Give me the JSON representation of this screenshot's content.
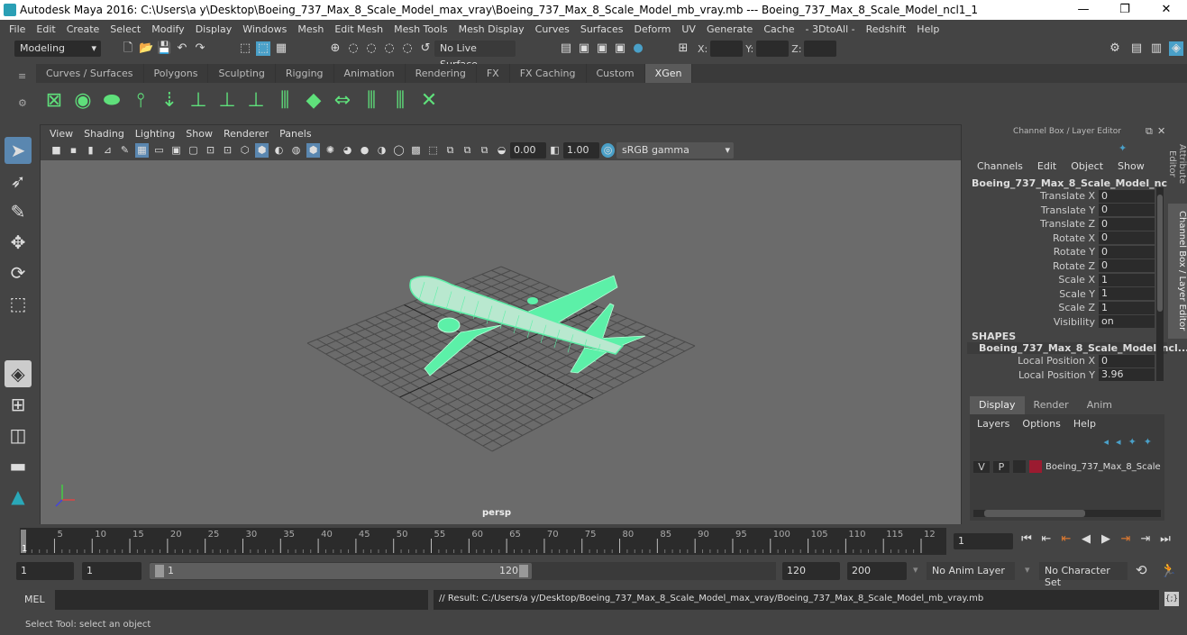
{
  "window": {
    "title": "Autodesk Maya 2016: C:\\Users\\a y\\Desktop\\Boeing_737_Max_8_Scale_Model_max_vray\\Boeing_737_Max_8_Scale_Model_mb_vray.mb  ---  Boeing_737_Max_8_Scale_Model_ncl1_1",
    "minimize": "—",
    "maximize": "❐",
    "close": "✕"
  },
  "menu": [
    "File",
    "Edit",
    "Create",
    "Select",
    "Modify",
    "Display",
    "Windows",
    "Mesh",
    "Edit Mesh",
    "Mesh Tools",
    "Mesh Display",
    "Curves",
    "Surfaces",
    "Deform",
    "UV",
    "Generate",
    "Cache",
    "- 3DtoAll -",
    "Redshift",
    "Help"
  ],
  "status": {
    "mode": "Modeling",
    "live_surface": "No Live Surface",
    "x_label": "X:",
    "y_label": "Y:",
    "z_label": "Z:"
  },
  "shelf": {
    "tabs": [
      "Curves / Surfaces",
      "Polygons",
      "Sculpting",
      "Rigging",
      "Animation",
      "Rendering",
      "FX",
      "FX Caching",
      "Custom",
      "XGen"
    ],
    "active": "XGen"
  },
  "viewport": {
    "menu": [
      "View",
      "Shading",
      "Lighting",
      "Show",
      "Renderer",
      "Panels"
    ],
    "exposure": "0.00",
    "gamma": "1.00",
    "color_space": "sRGB gamma",
    "camera": "persp"
  },
  "channel_box": {
    "title": "Channel Box / Layer Editor",
    "menu": [
      "Channels",
      "Edit",
      "Object",
      "Show"
    ],
    "object": "Boeing_737_Max_8_Scale_Model_ncl1_1",
    "channels": [
      {
        "label": "Translate X",
        "value": "0"
      },
      {
        "label": "Translate Y",
        "value": "0"
      },
      {
        "label": "Translate Z",
        "value": "0"
      },
      {
        "label": "Rotate X",
        "value": "0"
      },
      {
        "label": "Rotate Y",
        "value": "0"
      },
      {
        "label": "Rotate Z",
        "value": "0"
      },
      {
        "label": "Scale X",
        "value": "1"
      },
      {
        "label": "Scale Y",
        "value": "1"
      },
      {
        "label": "Scale Z",
        "value": "1"
      },
      {
        "label": "Visibility",
        "value": "on"
      }
    ],
    "shapes_header": "SHAPES",
    "shape_name": "Boeing_737_Max_8_Scale_Model_ncl...",
    "shape_channels": [
      {
        "label": "Local Position X",
        "value": "0"
      },
      {
        "label": "Local Position Y",
        "value": "3.96"
      }
    ]
  },
  "layer_editor": {
    "tabs": [
      "Display",
      "Render",
      "Anim"
    ],
    "active": "Display",
    "menu": [
      "Layers",
      "Options",
      "Help"
    ],
    "layer": {
      "v": "V",
      "p": "P",
      "name": "Boeing_737_Max_8_Scale",
      "color": "#9b1b30"
    }
  },
  "side_tabs": [
    "Attribute Editor",
    "Channel Box / Layer Editor"
  ],
  "timeline": {
    "ticks": [
      "5",
      "10",
      "15",
      "20",
      "25",
      "30",
      "35",
      "40",
      "45",
      "50",
      "55",
      "60",
      "65",
      "70",
      "75",
      "80",
      "85",
      "90",
      "95",
      "100",
      "105",
      "110",
      "115",
      "12"
    ],
    "current": "1",
    "current_field": "1"
  },
  "range": {
    "start": "1",
    "playback_start": "1",
    "slider_start": "1",
    "slider_end": "120",
    "playback_end": "120",
    "end": "200",
    "anim_layer": "No Anim Layer",
    "character_set": "No Character Set"
  },
  "command": {
    "label": "MEL",
    "result": "// Result: C:/Users/a y/Desktop/Boeing_737_Max_8_Scale_Model_max_vray/Boeing_737_Max_8_Scale_Model_mb_vray.mb"
  },
  "help_line": "Select Tool: select an object",
  "colors": {
    "wireframe": "#5cf0a8",
    "accent": "#4aa0c8",
    "timeline_marker": "#e07a30"
  }
}
